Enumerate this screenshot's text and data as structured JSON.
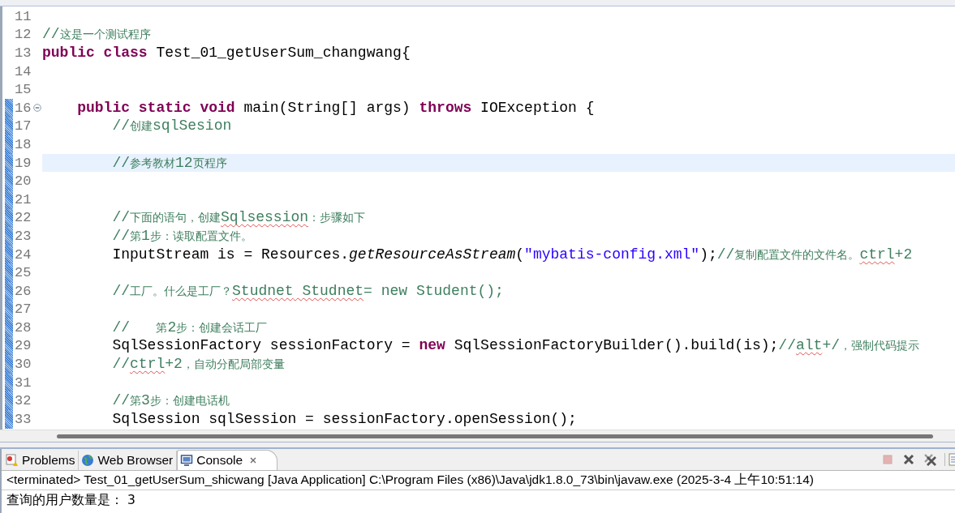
{
  "editor": {
    "lines": [
      {
        "number": "11",
        "changed": false,
        "current": false,
        "fold": false
      },
      {
        "number": "12",
        "changed": false,
        "current": false,
        "fold": false,
        "tokens": [
          {
            "kind": "comment",
            "text": "//"
          },
          {
            "kind": "note",
            "text": "这是一个测试程序"
          }
        ]
      },
      {
        "number": "13",
        "changed": false,
        "current": false,
        "fold": false,
        "tokens": [
          {
            "kind": "keyword",
            "text": "public class"
          },
          {
            "kind": "plain",
            "text": " Test_01_getUserSum_changwang{"
          }
        ]
      },
      {
        "number": "14",
        "changed": false,
        "current": false,
        "fold": false
      },
      {
        "number": "15",
        "changed": false,
        "current": false,
        "fold": false
      },
      {
        "number": "16",
        "changed": true,
        "current": false,
        "fold": true,
        "tokens": [
          {
            "kind": "keyword",
            "text": "    public static void"
          },
          {
            "kind": "plain",
            "text": " main(String[] args) "
          },
          {
            "kind": "keyword",
            "text": "throws"
          },
          {
            "kind": "plain",
            "text": " IOException {"
          }
        ]
      },
      {
        "number": "17",
        "changed": true,
        "current": false,
        "fold": false,
        "tokens": [
          {
            "kind": "comment",
            "text": "        //"
          },
          {
            "kind": "note",
            "text": "创建"
          },
          {
            "kind": "comment",
            "text": "sqlSesion"
          }
        ]
      },
      {
        "number": "18",
        "changed": true,
        "current": false,
        "fold": false
      },
      {
        "number": "19",
        "changed": true,
        "current": true,
        "fold": false,
        "tokens": [
          {
            "kind": "comment",
            "text": "        //"
          },
          {
            "kind": "note",
            "text": "参考教材"
          },
          {
            "kind": "comment",
            "text": "12"
          },
          {
            "kind": "note",
            "text": "页程序"
          }
        ]
      },
      {
        "number": "20",
        "changed": true,
        "current": false,
        "fold": false
      },
      {
        "number": "21",
        "changed": true,
        "current": false,
        "fold": false
      },
      {
        "number": "22",
        "changed": true,
        "current": false,
        "fold": false,
        "tokens": [
          {
            "kind": "comment",
            "text": "        //"
          },
          {
            "kind": "note",
            "text": "下面的语句，创建"
          },
          {
            "kind": "comment",
            "text": "Sqlsession",
            "squiggle": true
          },
          {
            "kind": "note",
            "text": "：步骤如下"
          }
        ]
      },
      {
        "number": "23",
        "changed": true,
        "current": false,
        "fold": false,
        "tokens": [
          {
            "kind": "comment",
            "text": "        //"
          },
          {
            "kind": "note",
            "text": "第"
          },
          {
            "kind": "comment",
            "text": "1"
          },
          {
            "kind": "note",
            "text": "步：读取配置文件。"
          }
        ]
      },
      {
        "number": "24",
        "changed": true,
        "current": false,
        "fold": false,
        "tokens": [
          {
            "kind": "plain",
            "text": "        InputStream is = Resources."
          },
          {
            "kind": "static",
            "text": "getResourceAsStream"
          },
          {
            "kind": "plain",
            "text": "("
          },
          {
            "kind": "string",
            "text": "\"mybatis-config.xml\""
          },
          {
            "kind": "plain",
            "text": ");"
          },
          {
            "kind": "comment",
            "text": "//"
          },
          {
            "kind": "note",
            "text": "复制配置文件的文件名。"
          },
          {
            "kind": "comment",
            "text": "ctrl",
            "squiggle": true
          },
          {
            "kind": "comment",
            "text": "+2"
          }
        ]
      },
      {
        "number": "25",
        "changed": true,
        "current": false,
        "fold": false
      },
      {
        "number": "26",
        "changed": true,
        "current": false,
        "fold": false,
        "tokens": [
          {
            "kind": "comment",
            "text": "        //"
          },
          {
            "kind": "note",
            "text": "工厂。什么是工厂？"
          },
          {
            "kind": "comment",
            "text": "Studnet",
            "squiggle": true
          },
          {
            "kind": "comment",
            "text": " Studnet",
            "squiggle": true
          },
          {
            "kind": "comment",
            "text": "= new Student();"
          }
        ]
      },
      {
        "number": "27",
        "changed": true,
        "current": false,
        "fold": false
      },
      {
        "number": "28",
        "changed": true,
        "current": false,
        "fold": false,
        "tokens": [
          {
            "kind": "comment",
            "text": "        //   "
          },
          {
            "kind": "note",
            "text": "第"
          },
          {
            "kind": "comment",
            "text": "2"
          },
          {
            "kind": "note",
            "text": "步：创建会话工厂"
          }
        ]
      },
      {
        "number": "29",
        "changed": true,
        "current": false,
        "fold": false,
        "tokens": [
          {
            "kind": "plain",
            "text": "        SqlSessionFactory sessionFactory = "
          },
          {
            "kind": "keyword",
            "text": "new"
          },
          {
            "kind": "plain",
            "text": " SqlSessionFactoryBuilder().build(is);"
          },
          {
            "kind": "comment",
            "text": "//"
          },
          {
            "kind": "comment",
            "text": "alt",
            "squiggle": true
          },
          {
            "kind": "comment",
            "text": "+/"
          },
          {
            "kind": "note",
            "text": "，强制代码提示"
          }
        ]
      },
      {
        "number": "30",
        "changed": true,
        "current": false,
        "fold": false,
        "tokens": [
          {
            "kind": "comment",
            "text": "        //"
          },
          {
            "kind": "comment",
            "text": "ctrl",
            "squiggle": true
          },
          {
            "kind": "comment",
            "text": "+2"
          },
          {
            "kind": "note",
            "text": "，自动分配局部变量"
          }
        ]
      },
      {
        "number": "31",
        "changed": true,
        "current": false,
        "fold": false
      },
      {
        "number": "32",
        "changed": true,
        "current": false,
        "fold": false,
        "tokens": [
          {
            "kind": "comment",
            "text": "        //"
          },
          {
            "kind": "note",
            "text": "第"
          },
          {
            "kind": "comment",
            "text": "3"
          },
          {
            "kind": "note",
            "text": "步：创建电话机"
          }
        ]
      },
      {
        "number": "33",
        "changed": true,
        "current": false,
        "fold": false,
        "tokens": [
          {
            "kind": "plain",
            "text": "        SqlSession sqlSession = sessionFactory.openSession();"
          }
        ]
      }
    ]
  },
  "panel": {
    "tabs": [
      {
        "label": "Problems",
        "selected": false,
        "closable": false
      },
      {
        "label": "Web Browser",
        "selected": false,
        "closable": false
      },
      {
        "label": "Console",
        "selected": true,
        "closable": true
      }
    ],
    "toolbar": [
      {
        "kind": "stop",
        "disabled": true
      },
      {
        "kind": "remove",
        "disabled": false
      },
      {
        "kind": "remove-all",
        "disabled": false
      },
      {
        "kind": "page",
        "disabled": false
      }
    ],
    "console_header": "<terminated> Test_01_getUserSum_shicwang [Java Application] C:\\Program Files (x86)\\Java\\jdk1.8.0_73\\bin\\javaw.exe (2025-3-4 上午10:51:14)",
    "output": [
      "查询的用户数量是： 3"
    ]
  }
}
